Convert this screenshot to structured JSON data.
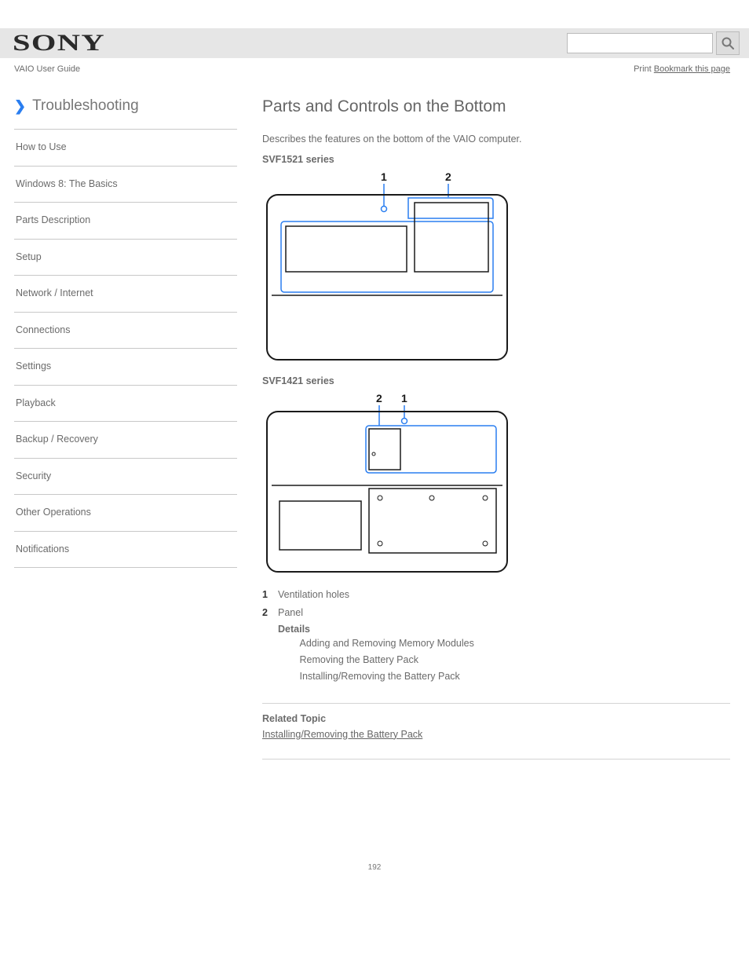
{
  "header": {
    "brand": "SONY",
    "search_placeholder": "",
    "user_guide": "VAIO User Guide",
    "feedback_prefix": "Print ",
    "feedback_link": "Bookmark this page"
  },
  "sidebar": {
    "title": "Troubleshooting",
    "items": [
      "How to Use",
      "Windows 8: The Basics",
      "Parts Description",
      "Setup",
      "Network / Internet",
      "Connections",
      "Settings",
      "Playback",
      "Backup / Recovery",
      "Security",
      "Other Operations",
      "Notifications"
    ]
  },
  "main": {
    "title": "Parts and Controls on the Bottom",
    "lead": "Describes the features on the bottom of the VAIO computer.",
    "model_a": "SVF1521 series",
    "model_b": "SVF1421 series",
    "numlist": [
      {
        "n": "1",
        "text": "Ventilation holes"
      },
      {
        "n": "2",
        "text": "Panel"
      }
    ],
    "bullets": [
      "Adding and Removing Memory Modules",
      "Removing the Battery Pack",
      "Installing/Removing the Battery Pack"
    ],
    "sub_label_details": "Details",
    "related_title": "Related Topic",
    "related_link": "Installing/Removing the Battery Pack"
  },
  "page_number": "192"
}
